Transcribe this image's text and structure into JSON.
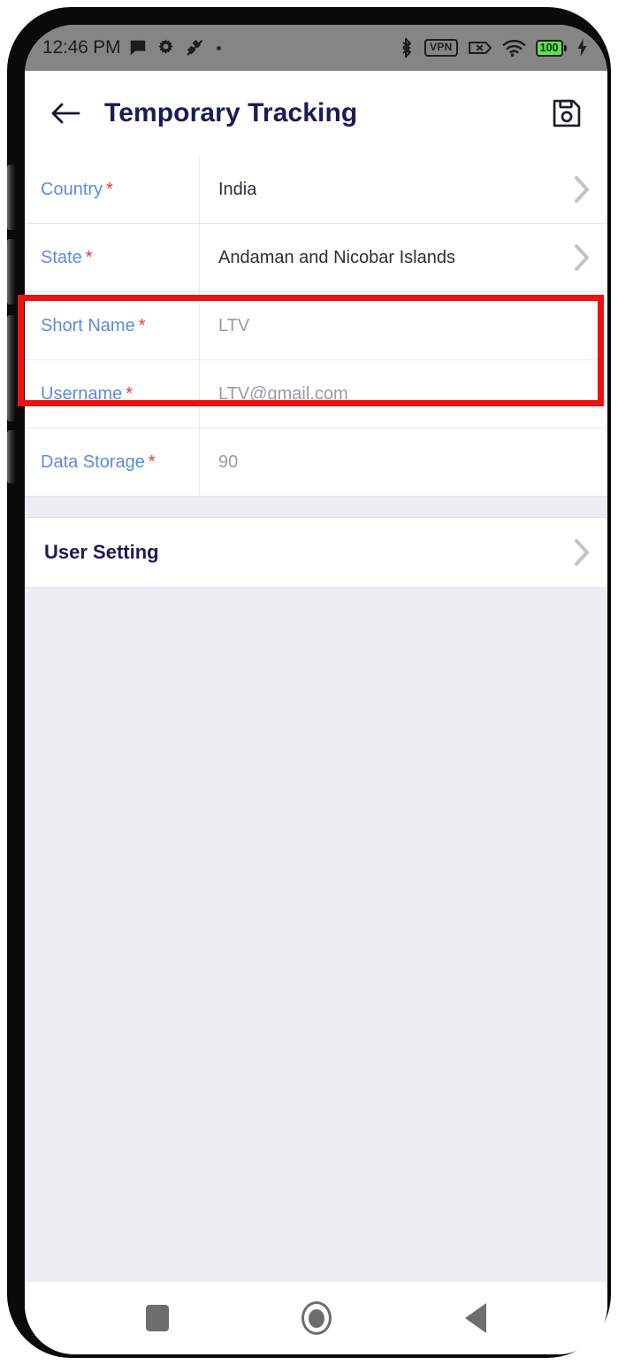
{
  "status_bar": {
    "time": "12:46 PM",
    "left_icons": [
      "message-icon",
      "gear-icon",
      "satellite-off-icon",
      "dot-separator-icon"
    ],
    "right_icons": [
      "bluetooth-icon",
      "vpn-icon",
      "sim-disabled-icon",
      "wifi-icon",
      "battery-icon",
      "charging-bolt-icon"
    ],
    "vpn_label": "VPN",
    "sim_label": "X",
    "battery_level": "100",
    "background_color": "#858585"
  },
  "app_bar": {
    "back_icon": "arrow-left-icon",
    "title": "Temporary Tracking",
    "save_icon": "floppy-save-icon",
    "title_color": "#1b1b56"
  },
  "form": {
    "rows": [
      {
        "label": "Country",
        "required": "*",
        "value": "India",
        "is_placeholder": false,
        "has_chevron": true
      },
      {
        "label": "State",
        "required": "*",
        "value": "Andaman and Nicobar Islands",
        "is_placeholder": false,
        "has_chevron": true
      },
      {
        "label": "Short Name",
        "required": "*",
        "value": "LTV",
        "is_placeholder": true,
        "has_chevron": false
      },
      {
        "label": "Username",
        "required": "*",
        "value": "LTV@gmail.com",
        "is_placeholder": true,
        "has_chevron": false
      },
      {
        "label": "Data Storage",
        "required": "*",
        "value": "90",
        "is_placeholder": true,
        "has_chevron": false
      }
    ],
    "label_color": "#5b8ce0",
    "required_color": "#e8382f"
  },
  "settings_section": {
    "label": "User Setting",
    "chevron_icon": "chevron-right-icon"
  },
  "bottom_nav": {
    "recents_icon": "square-recents-icon",
    "home_icon": "circle-home-icon",
    "back_icon": "triangle-back-icon"
  },
  "annotation": {
    "color": "#ee1111",
    "target_rows": [
      "Short Name",
      "Username"
    ]
  }
}
